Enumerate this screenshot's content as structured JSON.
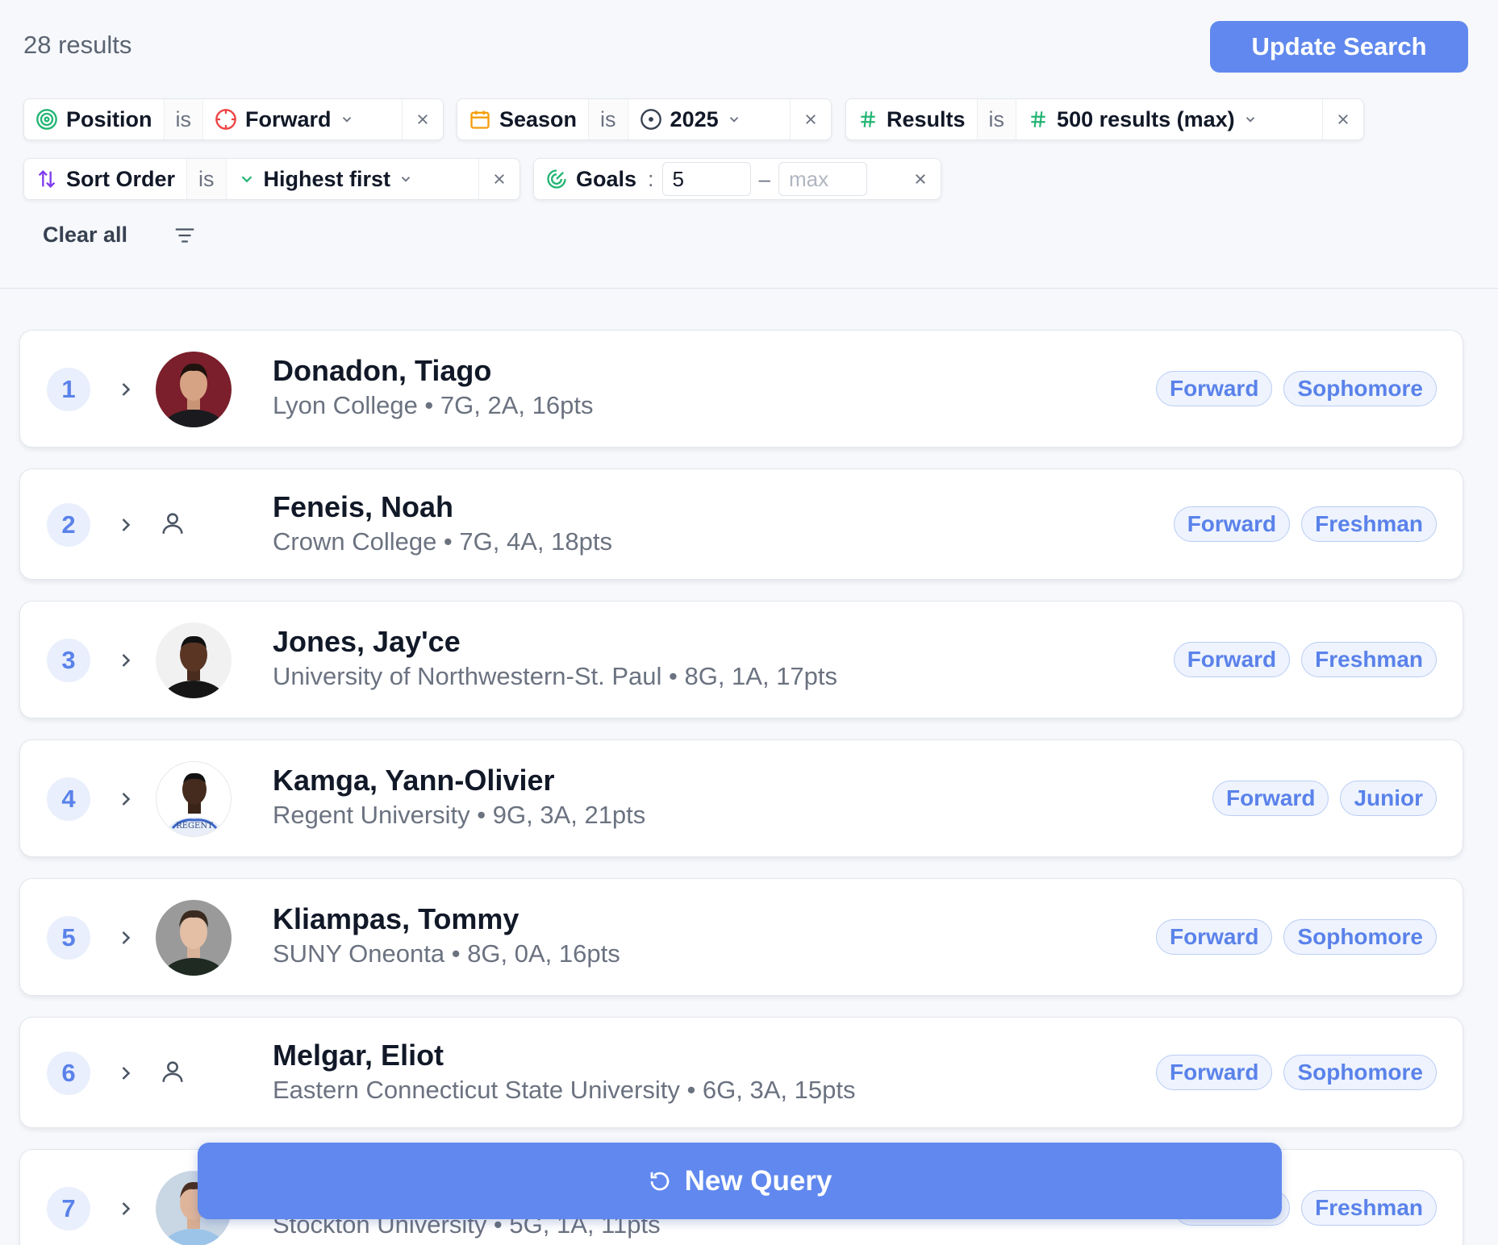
{
  "header": {
    "results_count": "28 results",
    "update_label": "Update Search"
  },
  "filters": {
    "position": {
      "field": "Position",
      "op": "is",
      "value": "Forward"
    },
    "season": {
      "field": "Season",
      "op": "is",
      "value": "2025"
    },
    "results": {
      "field": "Results",
      "op": "is",
      "value": "500 results (max)"
    },
    "sort": {
      "field": "Sort Order",
      "op": "is",
      "value": "Highest first"
    },
    "goals": {
      "field": "Goals",
      "op": ":",
      "min": "5",
      "dash": "–",
      "max_placeholder": "max"
    },
    "clear_all": "Clear all"
  },
  "icons": {
    "position": "target-icon",
    "position_value": "crosshair-icon",
    "season": "calendar-icon",
    "season_value": "clock-icon",
    "results": "hash-icon",
    "sort": "sort-arrows-icon",
    "sort_value": "chevron-down-icon",
    "goals": "goal-gauge-icon",
    "filter": "filter-lines-icon",
    "new_query": "refresh-icon"
  },
  "colors": {
    "accent": "#6088ee",
    "tag_text": "#5a82ea",
    "tag_bg": "#eef3fd",
    "tag_border": "#b9cdf6"
  },
  "players": [
    {
      "rank": "1",
      "name": "Donadon, Tiago",
      "sub": "Lyon College • 7G, 2A, 16pts",
      "tags": [
        "Forward",
        "Sophomore"
      ],
      "photo": "jersey-maroon"
    },
    {
      "rank": "2",
      "name": "Feneis, Noah",
      "sub": "Crown College • 7G, 4A, 18pts",
      "tags": [
        "Forward",
        "Freshman"
      ],
      "photo": "none"
    },
    {
      "rank": "3",
      "name": "Jones, Jay'ce",
      "sub": "University of Northwestern-St. Paul • 8G, 1A, 17pts",
      "tags": [
        "Forward",
        "Freshman"
      ],
      "photo": "jersey-black"
    },
    {
      "rank": "4",
      "name": "Kamga, Yann-Olivier",
      "sub": "Regent University • 9G, 3A, 21pts",
      "tags": [
        "Forward",
        "Junior"
      ],
      "photo": "jersey-white"
    },
    {
      "rank": "5",
      "name": "Kliampas, Tommy",
      "sub": "SUNY Oneonta • 8G, 0A, 16pts",
      "tags": [
        "Forward",
        "Sophomore"
      ],
      "photo": "jersey-dark-green"
    },
    {
      "rank": "6",
      "name": "Melgar, Eliot",
      "sub": "Eastern Connecticut State University • 6G, 3A, 15pts",
      "tags": [
        "Forward",
        "Sophomore"
      ],
      "photo": "none"
    },
    {
      "rank": "7",
      "name": "",
      "sub": "Stockton University • 5G, 1A, 11pts",
      "tags": [
        "Forward",
        "Freshman"
      ],
      "photo": "jersey-light-blue"
    }
  ],
  "regent_text": "REGENT",
  "new_query_label": "New Query"
}
